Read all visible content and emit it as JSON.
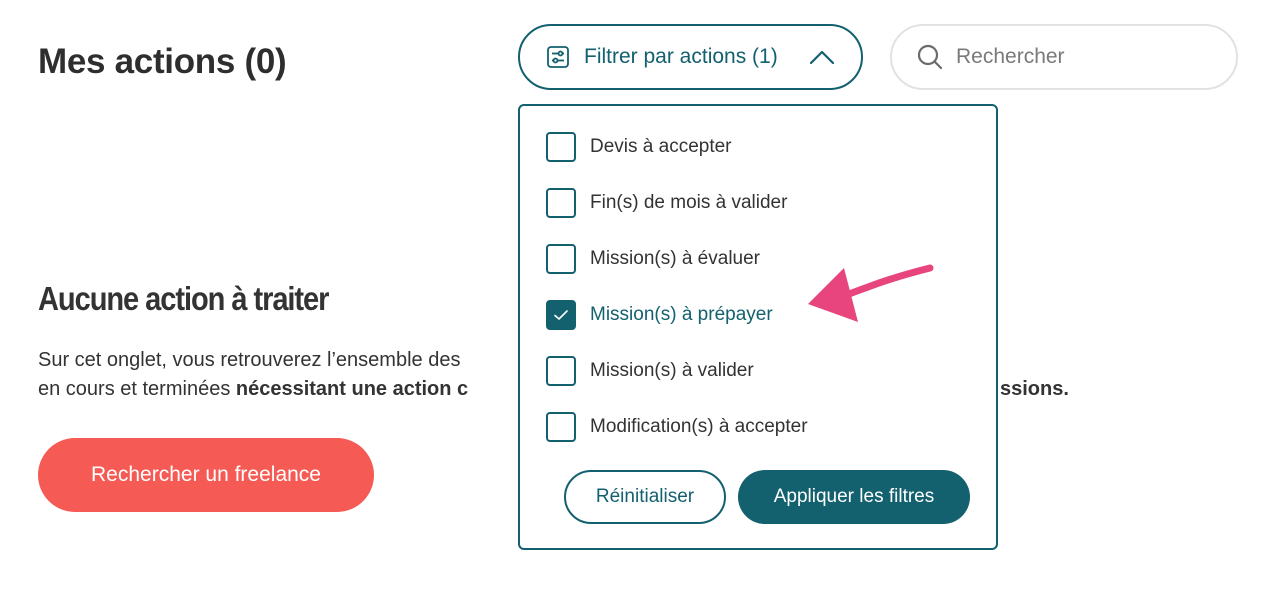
{
  "header": {
    "title": "Mes actions (0)",
    "filter_button_label": "Filtrer par actions (1)",
    "search_placeholder": "Rechercher"
  },
  "empty_state": {
    "title": "Aucune action à traiter",
    "line1": "Sur cet onglet, vous retrouverez l’ensemble des",
    "line2_prefix": "en cours et terminées ",
    "line2_bold": "nécessitant une action c",
    "line2_tail": "ssions.",
    "cta_label": "Rechercher un freelance"
  },
  "filter_dropdown": {
    "options": [
      {
        "label": "Devis à accepter",
        "checked": false
      },
      {
        "label": "Fin(s) de mois à valider",
        "checked": false
      },
      {
        "label": "Mission(s) à évaluer",
        "checked": false
      },
      {
        "label": "Mission(s) à prépayer",
        "checked": true
      },
      {
        "label": "Mission(s) à valider",
        "checked": false
      },
      {
        "label": "Modification(s) à accepter",
        "checked": false
      }
    ],
    "reset_label": "Réinitialiser",
    "apply_label": "Appliquer les filtres"
  },
  "colors": {
    "primary": "#13606f",
    "cta": "#f55a54",
    "annotation_arrow": "#e8457e"
  },
  "icons": {
    "filter": "sliders-icon",
    "chevron": "chevron-up-icon",
    "search": "search-icon",
    "check": "checkmark-icon",
    "annotation": "arrow-annotation-icon"
  }
}
